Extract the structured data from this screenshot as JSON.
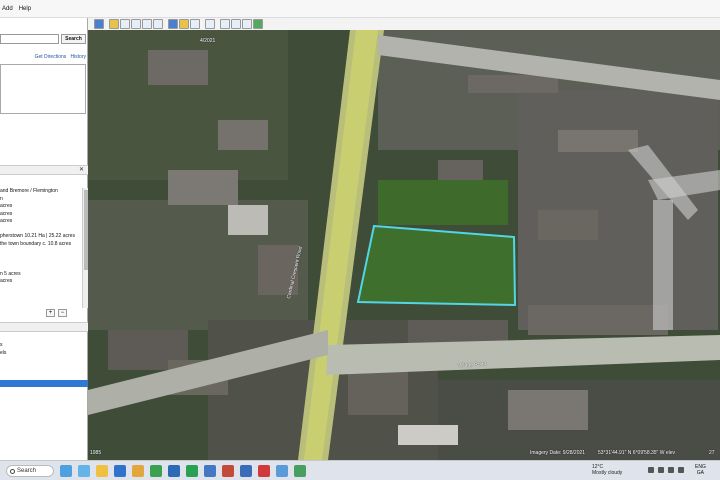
{
  "menu": {
    "items": [
      "Add",
      "Help"
    ]
  },
  "search": {
    "button_label": "Search",
    "placeholder": ""
  },
  "directions": {
    "get_directions": "Get Directions",
    "history": "History"
  },
  "places": {
    "close_label": "✕",
    "items": [
      "and Bremore / Flemington",
      "n",
      "acres",
      "acres",
      "acres",
      "",
      "pherstown 10.21 Ha | 25.22 acres",
      "the town boundary c. 10.8 acres",
      "",
      "",
      "",
      "n 5 acres",
      "acres",
      "",
      "",
      "",
      "lusk"
    ],
    "add_label": "+",
    "remove_label": "−"
  },
  "layers": {
    "items": [
      "s",
      "els"
    ]
  },
  "map": {
    "date_overlay": "4/2021",
    "road_labels": {
      "village_road": "Village Road",
      "main_road": "Cardinal Crescent Road"
    },
    "footer_left": "1985",
    "imagery_date": "Imagery Date: 9/28/2021",
    "coordinates": "53°31'44.91\" N   6°09'58.35\" W   elev",
    "elevation": "27",
    "outline_color": "#52d6e6"
  },
  "taskbar": {
    "search_label": "Search",
    "weather_temp": "12°C",
    "weather_desc": "Mostly cloudy",
    "lang_line1": "ENG",
    "lang_line2": "GA"
  },
  "colors": {
    "accent": "#2f78d4",
    "road": "#c2c8ae",
    "main_road": "#d8d96c"
  }
}
